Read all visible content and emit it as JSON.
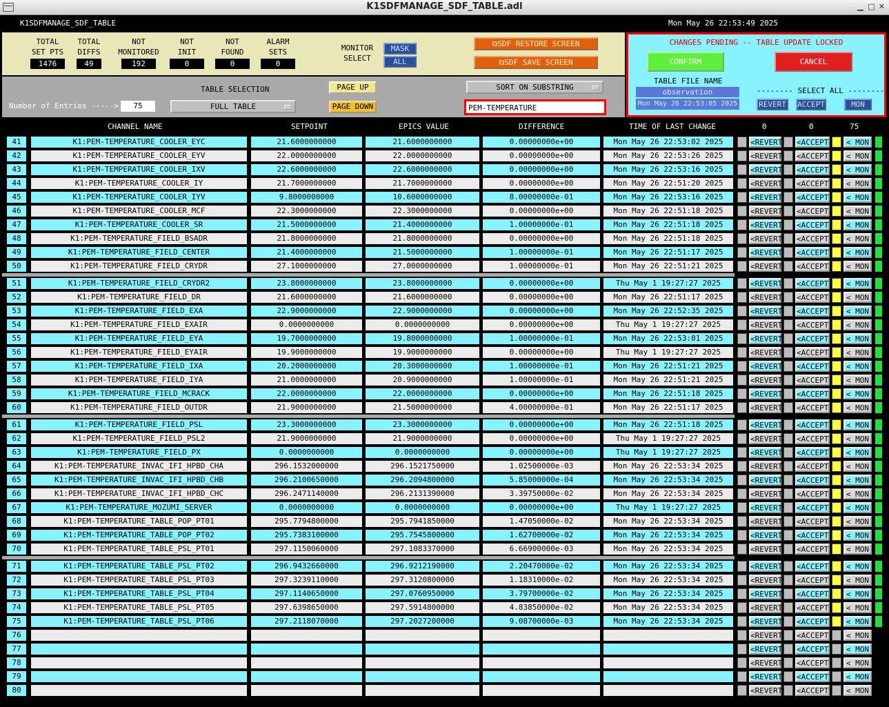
{
  "window": {
    "title": "K1SDFMANAGE_SDF_TABLE.adl",
    "screen_id": "K1SDFMANAGE_SDF_TABLE",
    "datetime": "Mon May 26 22:53:49 2025"
  },
  "stats": [
    {
      "label1": "TOTAL",
      "label2": "SET PTS",
      "value": "1476"
    },
    {
      "label1": "TOTAL",
      "label2": "DIFFS",
      "value": "49"
    },
    {
      "label1": "NOT",
      "label2": "MONITORED",
      "value": "192"
    },
    {
      "label1": "NOT",
      "label2": "INIT",
      "value": "0"
    },
    {
      "label1": "NOT",
      "label2": "FOUND",
      "value": "0"
    },
    {
      "label1": "ALARM",
      "label2": "SETS",
      "value": "0"
    }
  ],
  "monitor": {
    "label1": "MONITOR",
    "label2": "SELECT",
    "mask": "MASK",
    "all": "ALL"
  },
  "actions": {
    "restore": "SDF RESTORE SCREEN",
    "save": "SDF SAVE SCREEN"
  },
  "pending": {
    "status": "CHANGES PENDING -- TABLE UPDATE LOCKED",
    "confirm": "CONFIRM",
    "cancel": "CANCEL",
    "file_label": "TABLE FILE NAME",
    "file_name": "observation",
    "file_time": "Mon May 26 22:53:05 2025",
    "select_all": "-------- SELECT ALL --------",
    "revert": "REVERT",
    "accept": "ACCEPT",
    "mon": "MON"
  },
  "controls": {
    "entries_label": "Number of Entries ----->",
    "entries": "75",
    "table_selection_label": "TABLE SELECTION",
    "table_selection": "FULL TABLE",
    "page_up": "PAGE UP",
    "page_down": "PAGE DOWN",
    "sort_label": "SORT ON SUBSTRING",
    "filter": "PEM-TEMPERATURE"
  },
  "columns": {
    "name": "CHANNEL NAME",
    "setpoint": "SETPOINT",
    "epics": "EPICS VALUE",
    "diff": "DIFFERENCE",
    "time": "TIME OF LAST CHANGE",
    "count1": "0",
    "count2": "0",
    "count3": "75"
  },
  "row_buttons": {
    "revert": "<REVERT",
    "accept": "<ACCEPT",
    "mon": "< MON"
  },
  "rows": [
    {
      "n": "41",
      "name": "K1:PEM-TEMPERATURE_COOLER_EYC",
      "sp": "21.6000000000",
      "ev": "21.6000000000",
      "diff": "0.00000000e+00",
      "time": "Mon May 26 22:53:02 2025"
    },
    {
      "n": "42",
      "name": "K1:PEM-TEMPERATURE_COOLER_EYV",
      "sp": "22.0000000000",
      "ev": "22.0000000000",
      "diff": "0.00000000e+00",
      "time": "Mon May 26 22:53:26 2025"
    },
    {
      "n": "43",
      "name": "K1:PEM-TEMPERATURE_COOLER_IXV",
      "sp": "22.6000000000",
      "ev": "22.6000000000",
      "diff": "0.00000000e+00",
      "time": "Mon May 26 22:53:16 2025"
    },
    {
      "n": "44",
      "name": "K1:PEM-TEMPERATURE_COOLER_IY",
      "sp": "21.7000000000",
      "ev": "21.7000000000",
      "diff": "0.00000000e+00",
      "time": "Mon May 26 22:51:20 2025"
    },
    {
      "n": "45",
      "name": "K1:PEM-TEMPERATURE_COOLER_IYV",
      "sp": "9.8000000000",
      "ev": "10.6000000000",
      "diff": "8.00000000e-01",
      "time": "Mon May 26 22:53:16 2025"
    },
    {
      "n": "46",
      "name": "K1:PEM-TEMPERATURE_COOLER_MCF",
      "sp": "22.3000000000",
      "ev": "22.3000000000",
      "diff": "0.00000000e+00",
      "time": "Mon May 26 22:51:18 2025"
    },
    {
      "n": "47",
      "name": "K1:PEM-TEMPERATURE_COOLER_SR",
      "sp": "21.5000000000",
      "ev": "21.4000000000",
      "diff": "1.00000000e-01",
      "time": "Mon May 26 22:51:18 2025"
    },
    {
      "n": "48",
      "name": "K1:PEM-TEMPERATURE_FIELD_BSADR",
      "sp": "21.8000000000",
      "ev": "21.8000000000",
      "diff": "0.00000000e+00",
      "time": "Mon May 26 22:51:18 2025"
    },
    {
      "n": "49",
      "name": "K1:PEM-TEMPERATURE_FIELD_CENTER",
      "sp": "21.4000000000",
      "ev": "21.5000000000",
      "diff": "1.00000000e-01",
      "time": "Mon May 26 22:51:17 2025"
    },
    {
      "n": "50",
      "name": "K1:PEM-TEMPERATURE_FIELD_CRYDR",
      "sp": "27.1000000000",
      "ev": "27.0000000000",
      "diff": "1.00000000e-01",
      "time": "Mon May 26 22:51:21 2025"
    },
    {
      "n": "51",
      "name": "K1:PEM-TEMPERATURE_FIELD_CRYDR2",
      "sp": "23.8000000000",
      "ev": "23.8000000000",
      "diff": "0.00000000e+00",
      "time": "Thu May  1 19:27:27 2025"
    },
    {
      "n": "52",
      "name": "K1:PEM-TEMPERATURE_FIELD_DR",
      "sp": "21.6000000000",
      "ev": "21.6000000000",
      "diff": "0.00000000e+00",
      "time": "Mon May 26 22:51:17 2025"
    },
    {
      "n": "53",
      "name": "K1:PEM-TEMPERATURE_FIELD_EXA",
      "sp": "22.9000000000",
      "ev": "22.9000000000",
      "diff": "0.00000000e+00",
      "time": "Mon May 26 22:52:35 2025"
    },
    {
      "n": "54",
      "name": "K1:PEM-TEMPERATURE_FIELD_EXAIR",
      "sp": "0.0000000000",
      "ev": "0.0000000000",
      "diff": "0.00000000e+00",
      "time": "Thu May  1 19:27:27 2025"
    },
    {
      "n": "55",
      "name": "K1:PEM-TEMPERATURE_FIELD_EYA",
      "sp": "19.7000000000",
      "ev": "19.8000000000",
      "diff": "1.00000000e-01",
      "time": "Mon May 26 22:53:01 2025"
    },
    {
      "n": "56",
      "name": "K1:PEM-TEMPERATURE_FIELD_EYAIR",
      "sp": "19.9000000000",
      "ev": "19.9000000000",
      "diff": "0.00000000e+00",
      "time": "Thu May  1 19:27:27 2025"
    },
    {
      "n": "57",
      "name": "K1:PEM-TEMPERATURE_FIELD_IXA",
      "sp": "20.2000000000",
      "ev": "20.3000000000",
      "diff": "1.00000000e-01",
      "time": "Mon May 26 22:51:21 2025"
    },
    {
      "n": "58",
      "name": "K1:PEM-TEMPERATURE_FIELD_IYA",
      "sp": "21.0000000000",
      "ev": "20.9000000000",
      "diff": "1.00000000e-01",
      "time": "Mon May 26 22:51:21 2025"
    },
    {
      "n": "59",
      "name": "K1:PEM-TEMPERATURE_FIELD_MCRACK",
      "sp": "22.0000000000",
      "ev": "22.0000000000",
      "diff": "0.00000000e+00",
      "time": "Mon May 26 22:51:18 2025"
    },
    {
      "n": "60",
      "name": "K1:PEM-TEMPERATURE_FIELD_OUTDR",
      "sp": "21.9000000000",
      "ev": "21.5000000000",
      "diff": "4.00000000e-01",
      "time": "Mon May 26 22:51:17 2025"
    },
    {
      "n": "61",
      "name": "K1:PEM-TEMPERATURE_FIELD_PSL",
      "sp": "23.3000000000",
      "ev": "23.3000000000",
      "diff": "0.00000000e+00",
      "time": "Mon May 26 22:51:18 2025"
    },
    {
      "n": "62",
      "name": "K1:PEM-TEMPERATURE_FIELD_PSL2",
      "sp": "21.9000000000",
      "ev": "21.9000000000",
      "diff": "0.00000000e+00",
      "time": "Thu May  1 19:27:27 2025"
    },
    {
      "n": "63",
      "name": "K1:PEM-TEMPERATURE_FIELD_PX",
      "sp": "0.0000000000",
      "ev": "0.0000000000",
      "diff": "0.00000000e+00",
      "time": "Thu May  1 19:27:27 2025"
    },
    {
      "n": "64",
      "name": "K1:PEM-TEMPERATURE_INVAC_IFI_HPBD_CHA",
      "sp": "296.1532000000",
      "ev": "296.1521750000",
      "diff": "1.02500000e-03",
      "time": "Mon May 26 22:53:34 2025"
    },
    {
      "n": "65",
      "name": "K1:PEM-TEMPERATURE_INVAC_IFI_HPBD_CHB",
      "sp": "296.2100650000",
      "ev": "296.2094800000",
      "diff": "5.85000000e-04",
      "time": "Mon May 26 22:53:34 2025"
    },
    {
      "n": "66",
      "name": "K1:PEM-TEMPERATURE_INVAC_IFI_HPBD_CHC",
      "sp": "296.2471140000",
      "ev": "296.2131390000",
      "diff": "3.39750000e-02",
      "time": "Mon May 26 22:53:34 2025"
    },
    {
      "n": "67",
      "name": "K1:PEM-TEMPERATURE_MOZUMI_SERVER",
      "sp": "0.0000000000",
      "ev": "0.0000000000",
      "diff": "0.00000000e+00",
      "time": "Thu May  1 19:27:27 2025"
    },
    {
      "n": "68",
      "name": "K1:PEM-TEMPERATURE_TABLE_POP_PT01",
      "sp": "295.7794800000",
      "ev": "295.7941850000",
      "diff": "1.47050000e-02",
      "time": "Mon May 26 22:53:34 2025"
    },
    {
      "n": "69",
      "name": "K1:PEM-TEMPERATURE_TABLE_POP_PT02",
      "sp": "295.7383100000",
      "ev": "295.7545800000",
      "diff": "1.62700000e-02",
      "time": "Mon May 26 22:53:34 2025"
    },
    {
      "n": "70",
      "name": "K1:PEM-TEMPERATURE_TABLE_PSL_PT01",
      "sp": "297.1150060000",
      "ev": "297.1083370000",
      "diff": "6.66900000e-03",
      "time": "Mon May 26 22:53:34 2025"
    },
    {
      "n": "71",
      "name": "K1:PEM-TEMPERATURE_TABLE_PSL_PT02",
      "sp": "296.9432660000",
      "ev": "296.9212190000",
      "diff": "2.20470000e-02",
      "time": "Mon May 26 22:53:34 2025"
    },
    {
      "n": "72",
      "name": "K1:PEM-TEMPERATURE_TABLE_PSL_PT03",
      "sp": "297.3239110000",
      "ev": "297.3120800000",
      "diff": "1.18310000e-02",
      "time": "Mon May 26 22:53:34 2025"
    },
    {
      "n": "73",
      "name": "K1:PEM-TEMPERATURE_TABLE_PSL_PT04",
      "sp": "297.1140650000",
      "ev": "297.0760950000",
      "diff": "3.79700000e-02",
      "time": "Mon May 26 22:53:34 2025"
    },
    {
      "n": "74",
      "name": "K1:PEM-TEMPERATURE_TABLE_PSL_PT05",
      "sp": "297.6398650000",
      "ev": "297.5914800000",
      "diff": "4.83850000e-02",
      "time": "Mon May 26 22:53:34 2025"
    },
    {
      "n": "75",
      "name": "K1:PEM-TEMPERATURE_TABLE_PSL_PT06",
      "sp": "297.2118070000",
      "ev": "297.2027200000",
      "diff": "9.08700000e-03",
      "time": "Mon May 26 22:53:34 2025"
    },
    {
      "n": "76",
      "name": "",
      "sp": "",
      "ev": "",
      "diff": "",
      "time": ""
    },
    {
      "n": "77",
      "name": "",
      "sp": "",
      "ev": "",
      "diff": "",
      "time": ""
    },
    {
      "n": "78",
      "name": "",
      "sp": "",
      "ev": "",
      "diff": "",
      "time": ""
    },
    {
      "n": "79",
      "name": "",
      "sp": "",
      "ev": "",
      "diff": "",
      "time": ""
    },
    {
      "n": "80",
      "name": "",
      "sp": "",
      "ev": "",
      "diff": "",
      "time": ""
    }
  ],
  "colors": {
    "cyan": "#88f2ff",
    "grey_row": "#ebebeb",
    "yellow": "#ffff40",
    "green": "#20e040",
    "accent_red": "#ff0000"
  }
}
